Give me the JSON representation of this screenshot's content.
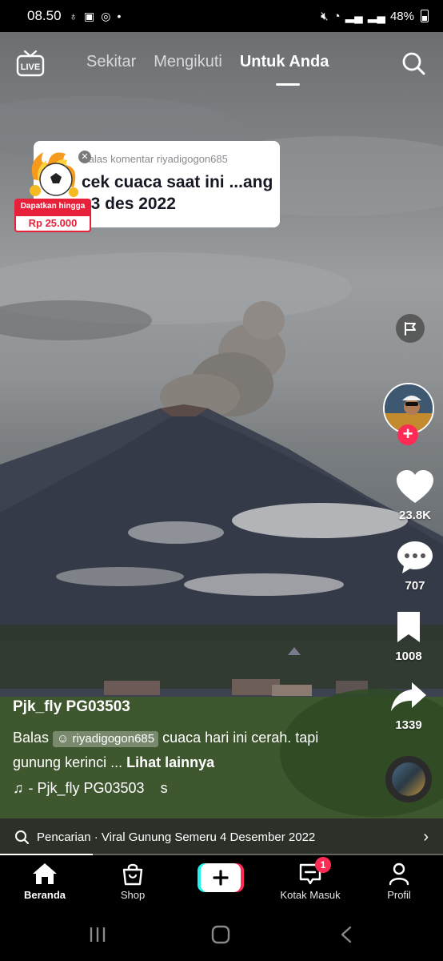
{
  "status_bar": {
    "time": "08.50",
    "battery": "48%"
  },
  "top_nav": {
    "live_label": "LIVE",
    "tabs": [
      {
        "label": "Sekitar",
        "active": false
      },
      {
        "label": "Mengikuti",
        "active": false
      },
      {
        "label": "Untuk Anda",
        "active": true
      }
    ]
  },
  "reply_sticker": {
    "header": "Balas komentar riyadigogon685",
    "text": "cek cuaca saat ini ...ang , 3 des 2022"
  },
  "promo": {
    "label": "Dapatkan hingga",
    "amount": "Rp 25.000"
  },
  "rail": {
    "likes": "23.8K",
    "comments": "707",
    "bookmarks": "1008",
    "shares": "1339"
  },
  "caption": {
    "author": "Pjk_fly PG03503",
    "desc_prefix": "Balas",
    "mention": "riyadigogon685",
    "desc_text": "cuaca hari ini cerah. tapi gunung kerinci ...",
    "see_more": "Lihat lainnya",
    "music": "- Pjk_fly PG03503",
    "music_trail": "s"
  },
  "search_suggestion": {
    "text": "Pencarian · Viral Gunung Semeru 4 Desember 2022"
  },
  "progress": 0.21,
  "bottom_nav": {
    "items": [
      {
        "label": "Beranda",
        "active": true
      },
      {
        "label": "Shop",
        "active": false
      },
      {
        "label": "Kotak Masuk",
        "active": false,
        "badge": "1"
      },
      {
        "label": "Profil",
        "active": false
      }
    ]
  },
  "colors": {
    "accent": "#fe2c55",
    "cyan": "#25f4ee",
    "promo_red": "#e7213a"
  }
}
